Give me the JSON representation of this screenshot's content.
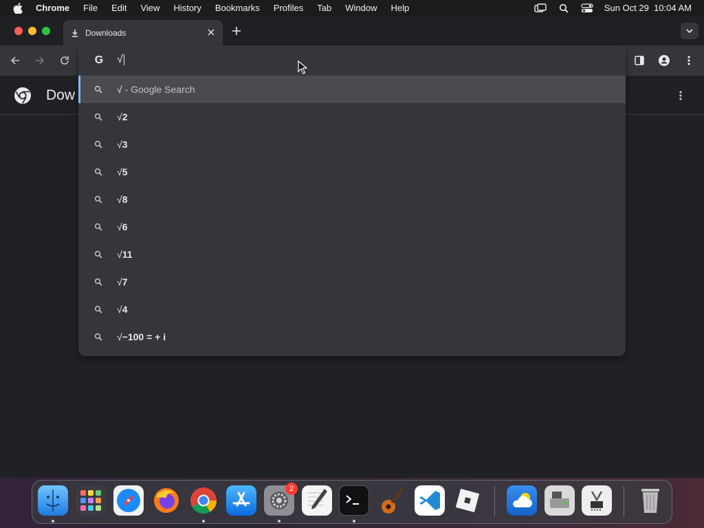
{
  "menubar": {
    "app_name": "Chrome",
    "items": [
      "File",
      "Edit",
      "View",
      "History",
      "Bookmarks",
      "Profiles",
      "Tab",
      "Window",
      "Help"
    ],
    "datetime": "Sun Oct 29  10:04 AM",
    "status_icons": [
      "screen-mirroring-icon",
      "spotlight-search-icon",
      "control-center-icon"
    ]
  },
  "tab": {
    "title": "Downloads",
    "icon": "download-icon"
  },
  "toolbar": {
    "back_icon": "arrow-left-icon",
    "forward_icon": "arrow-right-icon",
    "reload_icon": "reload-icon",
    "side_panel_icon": "side-panel-icon",
    "profile_icon": "profile-icon",
    "menu_icon": "more-vertical-icon"
  },
  "page": {
    "title": "Dow"
  },
  "omnibox": {
    "search_engine_icon": "G",
    "input_value": "√",
    "suggestions": [
      {
        "query": "√",
        "suffix": " - Google Search",
        "selected": true
      },
      {
        "query": "√",
        "completion": "2",
        "selected": false
      },
      {
        "query": "√",
        "completion": "3",
        "selected": false
      },
      {
        "query": "√",
        "completion": "5",
        "selected": false
      },
      {
        "query": "√",
        "completion": "8",
        "selected": false
      },
      {
        "query": "√",
        "completion": "6",
        "selected": false
      },
      {
        "query": "√",
        "completion": "11",
        "selected": false
      },
      {
        "query": "√",
        "completion": "7",
        "selected": false
      },
      {
        "query": "√",
        "completion": "4",
        "selected": false
      },
      {
        "query": "√",
        "completion": "−100 = + i",
        "selected": false
      }
    ]
  },
  "dock": {
    "apps": [
      {
        "name": "Finder",
        "running": true
      },
      {
        "name": "Launchpad",
        "running": false
      },
      {
        "name": "Safari",
        "running": false
      },
      {
        "name": "Firefox",
        "running": false
      },
      {
        "name": "Google Chrome",
        "running": true
      },
      {
        "name": "App Store",
        "running": false
      },
      {
        "name": "System Settings",
        "running": true,
        "badge": "2"
      },
      {
        "name": "TextEdit",
        "running": false
      },
      {
        "name": "Terminal",
        "running": true
      },
      {
        "name": "GarageBand",
        "running": false
      },
      {
        "name": "Visual Studio Code",
        "running": false
      },
      {
        "name": "Roblox",
        "running": false
      },
      {
        "name": "Weather",
        "running": false
      },
      {
        "name": "Disk Utility",
        "running": false
      },
      {
        "name": "System Information",
        "running": false
      },
      {
        "name": "Trash",
        "running": false
      }
    ]
  }
}
